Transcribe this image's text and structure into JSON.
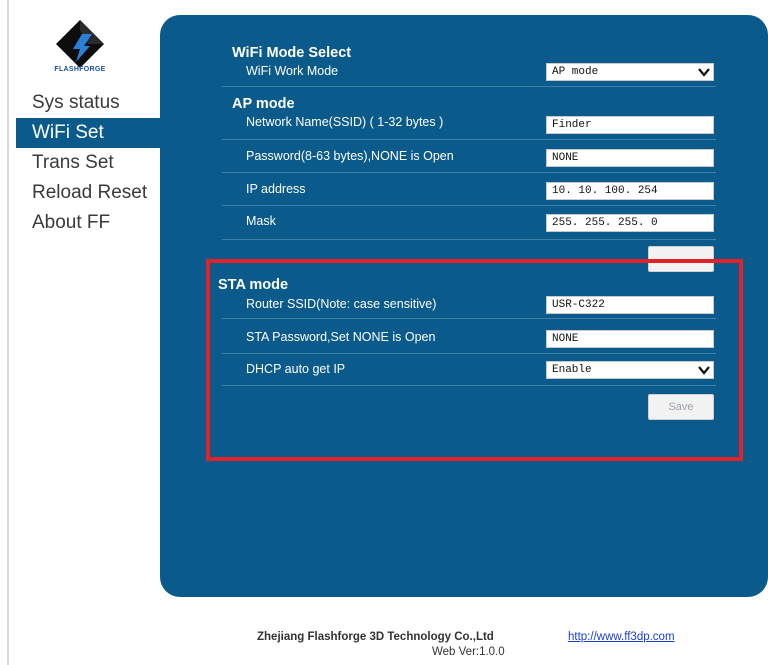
{
  "logo": {
    "text": "FLASHFORGE"
  },
  "sidebar": {
    "items": [
      {
        "label": "Sys status",
        "active": false
      },
      {
        "label": "WiFi Set",
        "active": true
      },
      {
        "label": "Trans Set",
        "active": false
      },
      {
        "label": "Reload Reset",
        "active": false
      },
      {
        "label": "About FF",
        "active": false
      }
    ]
  },
  "wifi_mode": {
    "title": "WiFi Mode Select",
    "work_mode_label": "WiFi Work Mode",
    "work_mode_value": "AP mode"
  },
  "ap_mode": {
    "title": "AP mode",
    "ssid_label": "Network Name(SSID) ( 1-32 bytes )",
    "ssid_value": "Finder",
    "password_label": "Password(8-63 bytes),NONE is Open",
    "password_value": "NONE",
    "ip_label": "IP address",
    "ip_value": "10. 10. 100. 254",
    "mask_label": "Mask",
    "mask_value": "255. 255. 255. 0"
  },
  "sta_mode": {
    "title": "STA mode",
    "router_ssid_label": "Router SSID(Note: case sensitive)",
    "router_ssid_value": "USR-C322",
    "password_label": "STA Password,Set NONE is Open",
    "password_value": "NONE",
    "dhcp_label": "DHCP auto get IP",
    "dhcp_value": "Enable",
    "save_label": "Save"
  },
  "footer": {
    "company": "Zhejiang Flashforge 3D Technology Co.,Ltd",
    "link": "http://www.ff3dp.com",
    "version": "Web Ver:1.0.0"
  },
  "colors": {
    "panel": "#0b5a8c",
    "active_nav": "#0b5a8c",
    "highlight": "#e22128"
  }
}
